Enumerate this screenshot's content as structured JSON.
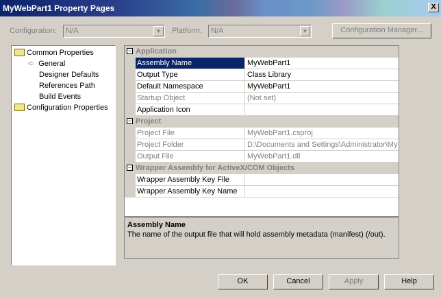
{
  "window": {
    "title": "MyWebPart1 Property Pages",
    "close": "X"
  },
  "toolbar": {
    "configuration_label": "Configuration:",
    "configuration_value": "N/A",
    "platform_label": "Platform:",
    "platform_value": "N/A",
    "config_manager": "Configuration Manager..."
  },
  "tree": {
    "items": [
      "Common Properties",
      "General",
      "Designer Defaults",
      "References Path",
      "Build Events",
      "Configuration Properties"
    ]
  },
  "grid": {
    "categories": [
      {
        "name": "Application",
        "rows": [
          [
            "Assembly Name",
            "MyWebPart1"
          ],
          [
            "Output Type",
            "Class Library"
          ],
          [
            "Default Namespace",
            "MyWebPart1"
          ],
          [
            "Startup Object",
            "(Not set)"
          ],
          [
            "Application Icon",
            ""
          ]
        ]
      },
      {
        "name": "Project",
        "rows": [
          [
            "Project File",
            "MyWebPart1.csproj"
          ],
          [
            "Project Folder",
            "D:\\Documents and Settings\\Administrator\\My Documents"
          ],
          [
            "Output File",
            "MyWebPart1.dll"
          ]
        ]
      },
      {
        "name": "Wrapper Assembly for ActiveX/COM Objects",
        "rows": [
          [
            "Wrapper Assembly Key File",
            ""
          ],
          [
            "Wrapper Assembly Key Name",
            ""
          ]
        ]
      }
    ]
  },
  "description": {
    "title": "Assembly Name",
    "text": "The name of the output file that will hold assembly metadata (manifest) (/out)."
  },
  "buttons": {
    "ok": "OK",
    "cancel": "Cancel",
    "apply": "Apply",
    "help": "Help"
  }
}
